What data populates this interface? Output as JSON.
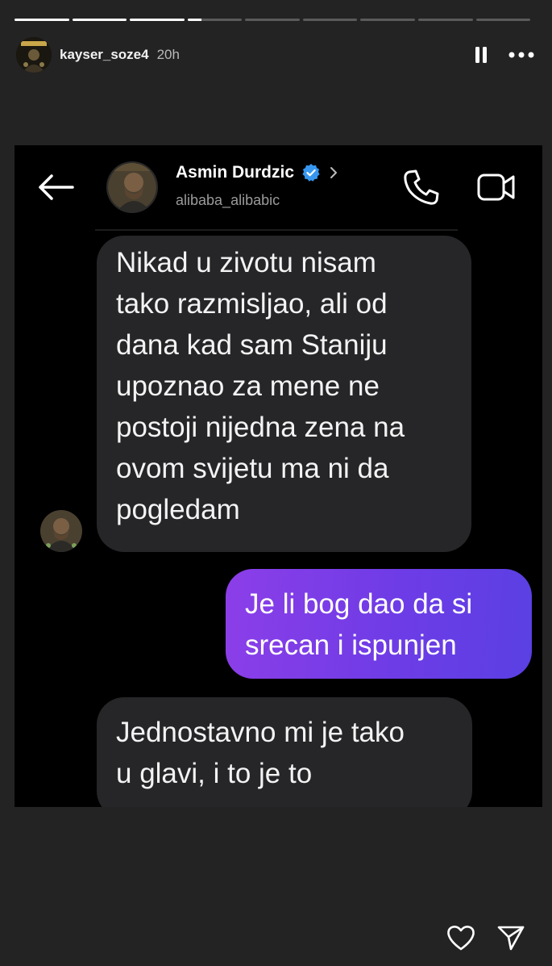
{
  "story": {
    "username": "kayser_soze4",
    "time_ago": "20h",
    "progress_segments": [
      1,
      1,
      1,
      0.25,
      0,
      0,
      0,
      0,
      0
    ],
    "avatar_icon": "profile-photo-avatar"
  },
  "chat": {
    "contact_name": "Asmin Durdzic",
    "contact_handle": "alibaba_alibabic",
    "verified_color": "#3797F0",
    "outgoing_bubble_colors": [
      "#8c3ee8",
      "#5a40e3"
    ],
    "messages": [
      {
        "direction": "incoming",
        "text": "Nikad u zivotu nisam\ntako razmisljao, ali od\ndana kad sam Staniju\nupoznao za mene ne\npostoji nijedna zena na\novom svijetu ma ni da\npogledam"
      },
      {
        "direction": "outgoing",
        "text": "Je li bog dao da si\nsrecan i ispunjen"
      },
      {
        "direction": "incoming",
        "text": "Jednostavno mi je tako\nu glavi, i to je to"
      }
    ]
  }
}
